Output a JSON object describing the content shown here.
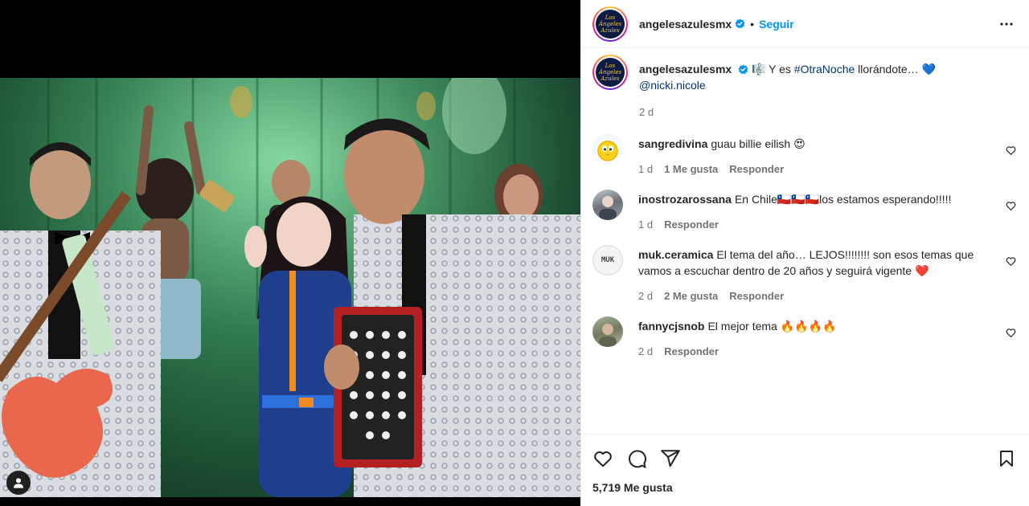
{
  "header": {
    "username": "angelesazulesmx",
    "separator": "•",
    "follow_label": "Seguir",
    "avatar_text": "Los Ángeles Azules"
  },
  "caption": {
    "username": "angelesazulesmx",
    "emoji_pre": "🎼",
    "text_pre": "Y es",
    "hashtag": "#OtraNoche",
    "text_post": "llorándote…",
    "emoji_post": "💙",
    "mention": "@nicki.nicole",
    "time": "2 d"
  },
  "comments": [
    {
      "username": "sangredivina",
      "text": "guau billie eilish 😍",
      "time": "1 d",
      "likes": "1 Me gusta",
      "reply": "Responder",
      "avatar": "tweety-avatar"
    },
    {
      "username": "inostrozarossana",
      "text": "En Chile🇨🇱🇨🇱🇨🇱los estamos esperando!!!!!",
      "time": "1 d",
      "likes": "",
      "reply": "Responder",
      "avatar": "person-avatar"
    },
    {
      "username": "muk.ceramica",
      "text": "El tema del año… LEJOS!!!!!!!! son esos temas que vamos a escuchar dentro de 20 años y seguirá vigente ❤️",
      "time": "2 d",
      "likes": "2 Me gusta",
      "reply": "Responder",
      "avatar": "muk-logo-avatar",
      "avatar_text": "MUK"
    },
    {
      "username": "fannycjsnob",
      "text": "El mejor tema 🔥🔥🔥🔥",
      "time": "2 d",
      "likes": "",
      "reply": "Responder",
      "avatar": "person-avatar"
    }
  ],
  "footer": {
    "likes_count": "5,719 Me gusta"
  },
  "icons": {
    "verified": "verified-badge-icon",
    "more": "more-options-icon",
    "heart": "heart-icon",
    "comment": "comment-icon",
    "share": "share-icon",
    "save": "bookmark-icon",
    "tag": "user-tag-icon"
  },
  "colors": {
    "accent": "#0095f6",
    "link": "#00376b",
    "text": "#262626",
    "muted": "#737373",
    "border": "#efefef"
  }
}
